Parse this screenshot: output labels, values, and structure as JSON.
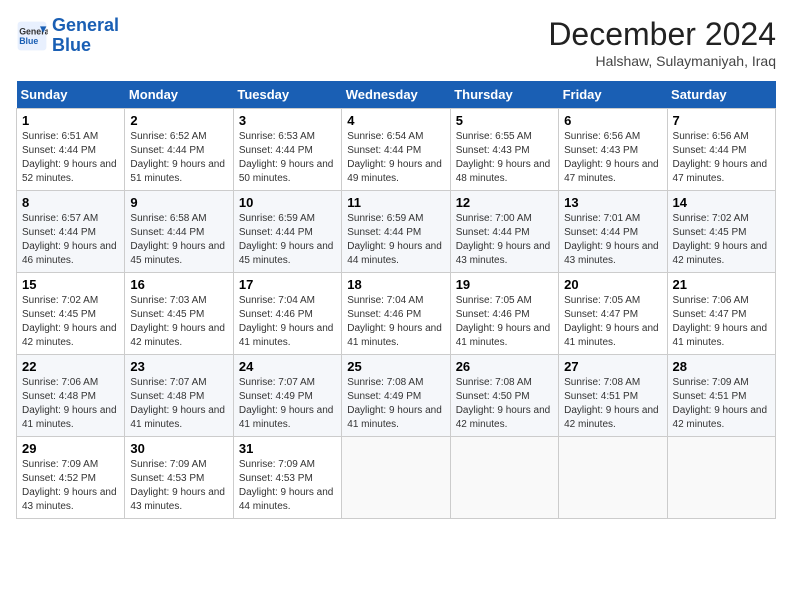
{
  "header": {
    "logo_line1": "General",
    "logo_line2": "Blue",
    "month_title": "December 2024",
    "location": "Halshaw, Sulaymaniyah, Iraq"
  },
  "weekdays": [
    "Sunday",
    "Monday",
    "Tuesday",
    "Wednesday",
    "Thursday",
    "Friday",
    "Saturday"
  ],
  "weeks": [
    [
      {
        "day": "1",
        "sunrise": "Sunrise: 6:51 AM",
        "sunset": "Sunset: 4:44 PM",
        "daylight": "Daylight: 9 hours and 52 minutes."
      },
      {
        "day": "2",
        "sunrise": "Sunrise: 6:52 AM",
        "sunset": "Sunset: 4:44 PM",
        "daylight": "Daylight: 9 hours and 51 minutes."
      },
      {
        "day": "3",
        "sunrise": "Sunrise: 6:53 AM",
        "sunset": "Sunset: 4:44 PM",
        "daylight": "Daylight: 9 hours and 50 minutes."
      },
      {
        "day": "4",
        "sunrise": "Sunrise: 6:54 AM",
        "sunset": "Sunset: 4:44 PM",
        "daylight": "Daylight: 9 hours and 49 minutes."
      },
      {
        "day": "5",
        "sunrise": "Sunrise: 6:55 AM",
        "sunset": "Sunset: 4:43 PM",
        "daylight": "Daylight: 9 hours and 48 minutes."
      },
      {
        "day": "6",
        "sunrise": "Sunrise: 6:56 AM",
        "sunset": "Sunset: 4:43 PM",
        "daylight": "Daylight: 9 hours and 47 minutes."
      },
      {
        "day": "7",
        "sunrise": "Sunrise: 6:56 AM",
        "sunset": "Sunset: 4:44 PM",
        "daylight": "Daylight: 9 hours and 47 minutes."
      }
    ],
    [
      {
        "day": "8",
        "sunrise": "Sunrise: 6:57 AM",
        "sunset": "Sunset: 4:44 PM",
        "daylight": "Daylight: 9 hours and 46 minutes."
      },
      {
        "day": "9",
        "sunrise": "Sunrise: 6:58 AM",
        "sunset": "Sunset: 4:44 PM",
        "daylight": "Daylight: 9 hours and 45 minutes."
      },
      {
        "day": "10",
        "sunrise": "Sunrise: 6:59 AM",
        "sunset": "Sunset: 4:44 PM",
        "daylight": "Daylight: 9 hours and 45 minutes."
      },
      {
        "day": "11",
        "sunrise": "Sunrise: 6:59 AM",
        "sunset": "Sunset: 4:44 PM",
        "daylight": "Daylight: 9 hours and 44 minutes."
      },
      {
        "day": "12",
        "sunrise": "Sunrise: 7:00 AM",
        "sunset": "Sunset: 4:44 PM",
        "daylight": "Daylight: 9 hours and 43 minutes."
      },
      {
        "day": "13",
        "sunrise": "Sunrise: 7:01 AM",
        "sunset": "Sunset: 4:44 PM",
        "daylight": "Daylight: 9 hours and 43 minutes."
      },
      {
        "day": "14",
        "sunrise": "Sunrise: 7:02 AM",
        "sunset": "Sunset: 4:45 PM",
        "daylight": "Daylight: 9 hours and 42 minutes."
      }
    ],
    [
      {
        "day": "15",
        "sunrise": "Sunrise: 7:02 AM",
        "sunset": "Sunset: 4:45 PM",
        "daylight": "Daylight: 9 hours and 42 minutes."
      },
      {
        "day": "16",
        "sunrise": "Sunrise: 7:03 AM",
        "sunset": "Sunset: 4:45 PM",
        "daylight": "Daylight: 9 hours and 42 minutes."
      },
      {
        "day": "17",
        "sunrise": "Sunrise: 7:04 AM",
        "sunset": "Sunset: 4:46 PM",
        "daylight": "Daylight: 9 hours and 41 minutes."
      },
      {
        "day": "18",
        "sunrise": "Sunrise: 7:04 AM",
        "sunset": "Sunset: 4:46 PM",
        "daylight": "Daylight: 9 hours and 41 minutes."
      },
      {
        "day": "19",
        "sunrise": "Sunrise: 7:05 AM",
        "sunset": "Sunset: 4:46 PM",
        "daylight": "Daylight: 9 hours and 41 minutes."
      },
      {
        "day": "20",
        "sunrise": "Sunrise: 7:05 AM",
        "sunset": "Sunset: 4:47 PM",
        "daylight": "Daylight: 9 hours and 41 minutes."
      },
      {
        "day": "21",
        "sunrise": "Sunrise: 7:06 AM",
        "sunset": "Sunset: 4:47 PM",
        "daylight": "Daylight: 9 hours and 41 minutes."
      }
    ],
    [
      {
        "day": "22",
        "sunrise": "Sunrise: 7:06 AM",
        "sunset": "Sunset: 4:48 PM",
        "daylight": "Daylight: 9 hours and 41 minutes."
      },
      {
        "day": "23",
        "sunrise": "Sunrise: 7:07 AM",
        "sunset": "Sunset: 4:48 PM",
        "daylight": "Daylight: 9 hours and 41 minutes."
      },
      {
        "day": "24",
        "sunrise": "Sunrise: 7:07 AM",
        "sunset": "Sunset: 4:49 PM",
        "daylight": "Daylight: 9 hours and 41 minutes."
      },
      {
        "day": "25",
        "sunrise": "Sunrise: 7:08 AM",
        "sunset": "Sunset: 4:49 PM",
        "daylight": "Daylight: 9 hours and 41 minutes."
      },
      {
        "day": "26",
        "sunrise": "Sunrise: 7:08 AM",
        "sunset": "Sunset: 4:50 PM",
        "daylight": "Daylight: 9 hours and 42 minutes."
      },
      {
        "day": "27",
        "sunrise": "Sunrise: 7:08 AM",
        "sunset": "Sunset: 4:51 PM",
        "daylight": "Daylight: 9 hours and 42 minutes."
      },
      {
        "day": "28",
        "sunrise": "Sunrise: 7:09 AM",
        "sunset": "Sunset: 4:51 PM",
        "daylight": "Daylight: 9 hours and 42 minutes."
      }
    ],
    [
      {
        "day": "29",
        "sunrise": "Sunrise: 7:09 AM",
        "sunset": "Sunset: 4:52 PM",
        "daylight": "Daylight: 9 hours and 43 minutes."
      },
      {
        "day": "30",
        "sunrise": "Sunrise: 7:09 AM",
        "sunset": "Sunset: 4:53 PM",
        "daylight": "Daylight: 9 hours and 43 minutes."
      },
      {
        "day": "31",
        "sunrise": "Sunrise: 7:09 AM",
        "sunset": "Sunset: 4:53 PM",
        "daylight": "Daylight: 9 hours and 44 minutes."
      },
      null,
      null,
      null,
      null
    ]
  ]
}
